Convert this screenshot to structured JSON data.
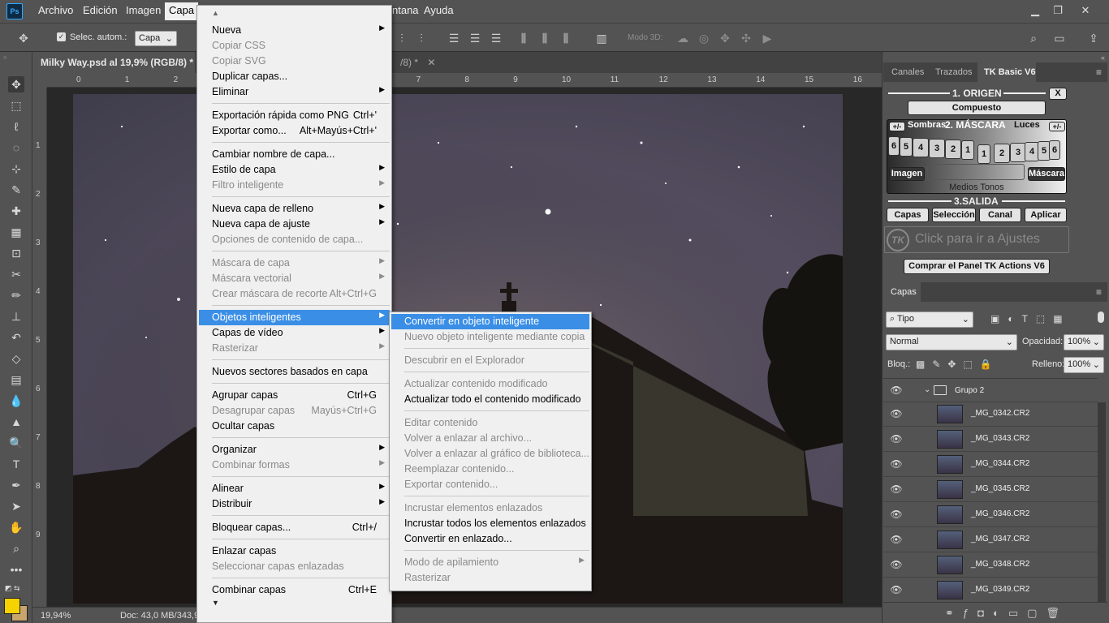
{
  "app": {
    "logo": "Ps"
  },
  "menubar": {
    "items": [
      "Archivo",
      "Edición",
      "Imagen",
      "Capa"
    ],
    "active": "Capa",
    "hidden_tail": [
      "ntana",
      "Ayuda"
    ]
  },
  "window_controls": {
    "minimize": "▁",
    "restore": "❐",
    "close": "✕"
  },
  "options_bar": {
    "auto_select_label": "Selec. autom.:",
    "auto_select_value": "Capa",
    "mode3d_label": "Modo 3D:"
  },
  "doc_tabs": [
    {
      "title": "Milky Way.psd al 19,9% (RGB/8) *",
      "close": "✕"
    },
    {
      "title": "/8) *",
      "close": "✕"
    }
  ],
  "ruler": {
    "h": [
      "0",
      "1",
      "2",
      "3",
      "4",
      "5",
      "6",
      "7",
      "8",
      "9",
      "10",
      "11",
      "12",
      "13",
      "14",
      "15",
      "16"
    ],
    "v": [
      "1",
      "2",
      "3",
      "4",
      "5",
      "6",
      "7",
      "8",
      "9"
    ]
  },
  "status": {
    "zoom": "19,94%",
    "doc": "Doc: 43,0 MB/343,9 M"
  },
  "menu_capa": [
    {
      "t": "sep_top"
    },
    {
      "label": "Nueva",
      "sub": true
    },
    {
      "label": "Copiar CSS",
      "dis": true
    },
    {
      "label": "Copiar SVG",
      "dis": true
    },
    {
      "label": "Duplicar capas..."
    },
    {
      "label": "Eliminar",
      "sub": true
    },
    {
      "t": "sep"
    },
    {
      "label": "Exportación rápida como PNG",
      "sc": "Ctrl+'"
    },
    {
      "label": "Exportar como...",
      "sc": "Alt+Mayús+Ctrl+'"
    },
    {
      "t": "sep"
    },
    {
      "label": "Cambiar nombre de capa..."
    },
    {
      "label": "Estilo de capa",
      "sub": true
    },
    {
      "label": "Filtro inteligente",
      "sub": true,
      "dis": true
    },
    {
      "t": "sep"
    },
    {
      "label": "Nueva capa de relleno",
      "sub": true
    },
    {
      "label": "Nueva capa de ajuste",
      "sub": true
    },
    {
      "label": "Opciones de contenido de capa...",
      "dis": true
    },
    {
      "t": "sep"
    },
    {
      "label": "Máscara de capa",
      "sub": true,
      "dis": true
    },
    {
      "label": "Máscara vectorial",
      "sub": true,
      "dis": true
    },
    {
      "label": "Crear máscara de recorte",
      "sc": "Alt+Ctrl+G",
      "dis": true
    },
    {
      "t": "sep"
    },
    {
      "label": "Objetos inteligentes",
      "sub": true,
      "hl": true
    },
    {
      "label": "Capas de vídeo",
      "sub": true
    },
    {
      "label": "Rasterizar",
      "sub": true,
      "dis": true
    },
    {
      "t": "sep"
    },
    {
      "label": "Nuevos sectores basados en capa"
    },
    {
      "t": "sep"
    },
    {
      "label": "Agrupar capas",
      "sc": "Ctrl+G"
    },
    {
      "label": "Desagrupar capas",
      "sc": "Mayús+Ctrl+G",
      "dis": true
    },
    {
      "label": "Ocultar capas"
    },
    {
      "t": "sep"
    },
    {
      "label": "Organizar",
      "sub": true
    },
    {
      "label": "Combinar formas",
      "sub": true,
      "dis": true
    },
    {
      "t": "sep"
    },
    {
      "label": "Alinear",
      "sub": true
    },
    {
      "label": "Distribuir",
      "sub": true
    },
    {
      "t": "sep"
    },
    {
      "label": "Bloquear capas...",
      "sc": "Ctrl+/"
    },
    {
      "t": "sep"
    },
    {
      "label": "Enlazar capas"
    },
    {
      "label": "Seleccionar capas enlazadas",
      "dis": true
    },
    {
      "t": "sep"
    },
    {
      "label": "Combinar capas",
      "sc": "Ctrl+E"
    },
    {
      "t": "more"
    }
  ],
  "menu_smart": [
    {
      "label": "Convertir en objeto inteligente",
      "hl": true
    },
    {
      "label": "Nuevo objeto inteligente mediante copia",
      "dis": true
    },
    {
      "t": "sep"
    },
    {
      "label": "Descubrir en el Explorador",
      "dis": true
    },
    {
      "t": "sep"
    },
    {
      "label": "Actualizar contenido modificado",
      "dis": true
    },
    {
      "label": "Actualizar todo el contenido modificado"
    },
    {
      "t": "sep"
    },
    {
      "label": "Editar contenido",
      "dis": true
    },
    {
      "label": "Volver a enlazar al archivo...",
      "dis": true
    },
    {
      "label": "Volver a enlazar al gráfico de biblioteca...",
      "dis": true
    },
    {
      "label": "Reemplazar contenido...",
      "dis": true
    },
    {
      "label": "Exportar contenido...",
      "dis": true
    },
    {
      "t": "sep"
    },
    {
      "label": "Incrustar elementos enlazados",
      "dis": true
    },
    {
      "label": "Incrustar todos los elementos enlazados"
    },
    {
      "label": "Convertir en enlazado..."
    },
    {
      "t": "sep"
    },
    {
      "label": "Modo de apilamiento",
      "sub": true,
      "dis": true
    },
    {
      "label": "Rasterizar",
      "dis": true
    }
  ],
  "panel_tabs": {
    "canales": "Canales",
    "trazados": "Trazados",
    "tk": "TK Basic V6"
  },
  "tk": {
    "origen": "1. ORIGEN",
    "x": "X",
    "compuesto": "Compuesto",
    "plusminus": "+/-",
    "sombras": "Sombras",
    "mascara_hdr": "2. MÁSCARA",
    "luces": "Luces",
    "dark_nums": [
      "6",
      "5",
      "4",
      "3",
      "2",
      "1"
    ],
    "light_nums": [
      "1",
      "2",
      "3",
      "4",
      "5",
      "6"
    ],
    "imagen": "Imagen",
    "mascara": "Máscara",
    "medios": "Medios Tonos",
    "salida": "3.SALIDA",
    "capas": "Capas",
    "seleccion": "Selección",
    "canal": "Canal",
    "aplicar": "Aplicar",
    "logo": "TK",
    "ajustes": "Click para ir a Ajustes",
    "comprar": "Comprar el Panel TK Actions V6"
  },
  "layers_panel": {
    "title": "Capas",
    "filter": "Tipo",
    "blend": "Normal",
    "opacity_label": "Opacidad:",
    "opacity": "100%",
    "lock_label": "Bloq.:",
    "fill_label": "Relleno:",
    "fill": "100%",
    "group": "Grupo 2",
    "layers": [
      "_MG_0342.CR2",
      "_MG_0343.CR2",
      "_MG_0344.CR2",
      "_MG_0345.CR2",
      "_MG_0346.CR2",
      "_MG_0347.CR2",
      "_MG_0348.CR2",
      "_MG_0349.CR2"
    ]
  },
  "colors": {
    "foreground": "#f5d200",
    "background": "#c8a56a",
    "highlight": "#3a8ee6"
  }
}
